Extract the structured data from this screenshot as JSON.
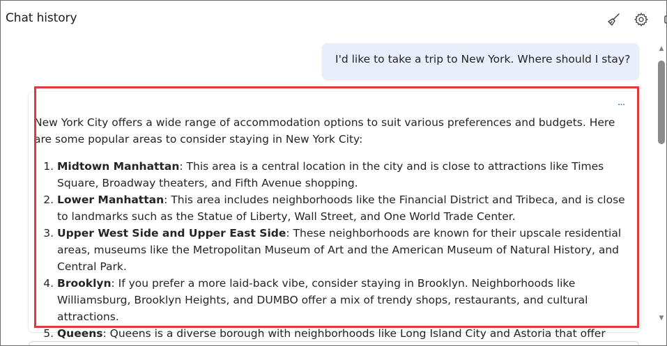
{
  "header": {
    "title": "Chat history",
    "icons": [
      "broom-icon",
      "gear-icon",
      "panel-icon"
    ]
  },
  "user_message": {
    "text": "I'd like to take a trip to New York. Where should I stay?"
  },
  "assistant_message": {
    "intro": "New York City offers a wide range of accommodation options to suit various preferences and budgets. Here are some popular areas to consider staying in New York City:",
    "more_label": "...",
    "items": [
      {
        "title": "Midtown Manhattan",
        "text": ": This area is a central location in the city and is close to attractions like Times Square, Broadway theaters, and Fifth Avenue shopping."
      },
      {
        "title": "Lower Manhattan",
        "text": ": This area includes neighborhoods like the Financial District and Tribeca, and is close to landmarks such as the Statue of Liberty, Wall Street, and One World Trade Center."
      },
      {
        "title": "Upper West Side and Upper East Side",
        "text": ": These neighborhoods are known for their upscale residential areas, museums like the Metropolitan Museum of Art and the American Museum of Natural History, and Central Park."
      },
      {
        "title": "Brooklyn",
        "text": ": If you prefer a more laid-back vibe, consider staying in Brooklyn. Neighborhoods like Williamsburg, Brooklyn Heights, and DUMBO offer a mix of trendy shops, restaurants, and cultural attractions."
      },
      {
        "title": "Queens",
        "text": ": Queens is a diverse borough with neighborhoods like Long Island City and Astoria that offer"
      }
    ]
  },
  "colors": {
    "user_bubble": "#e8effa",
    "highlight_border": "#e0393d",
    "accent": "#2a6dc3"
  }
}
